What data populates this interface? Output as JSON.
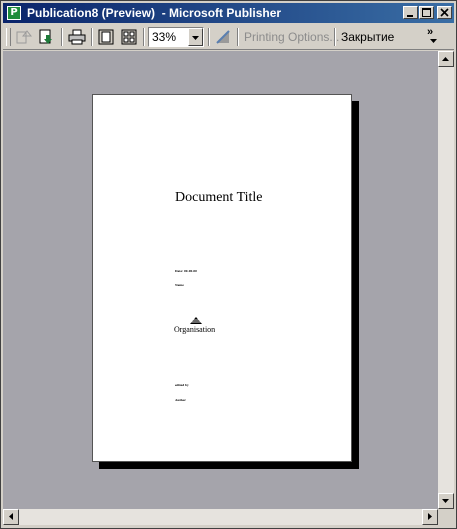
{
  "window": {
    "title_doc": "Publication8 (Preview)",
    "title_sep": "  - ",
    "title_app": "Microsoft Publisher",
    "icon_letter": "P"
  },
  "toolbar": {
    "zoom_value": "33%",
    "printing_options_label": "Printing Options...",
    "close_label": "Закрытие",
    "more_label": "»"
  },
  "page": {
    "document_title": "Document Title",
    "date_line": "Date: 00-00-00",
    "name_line": "Name",
    "organisation": "Organisation",
    "edited_by": "edited by",
    "author": "Author"
  },
  "colors": {
    "titlebar_start": "#0a246a",
    "titlebar_end": "#3a6ea5",
    "workspace": "#a5a4ab"
  }
}
